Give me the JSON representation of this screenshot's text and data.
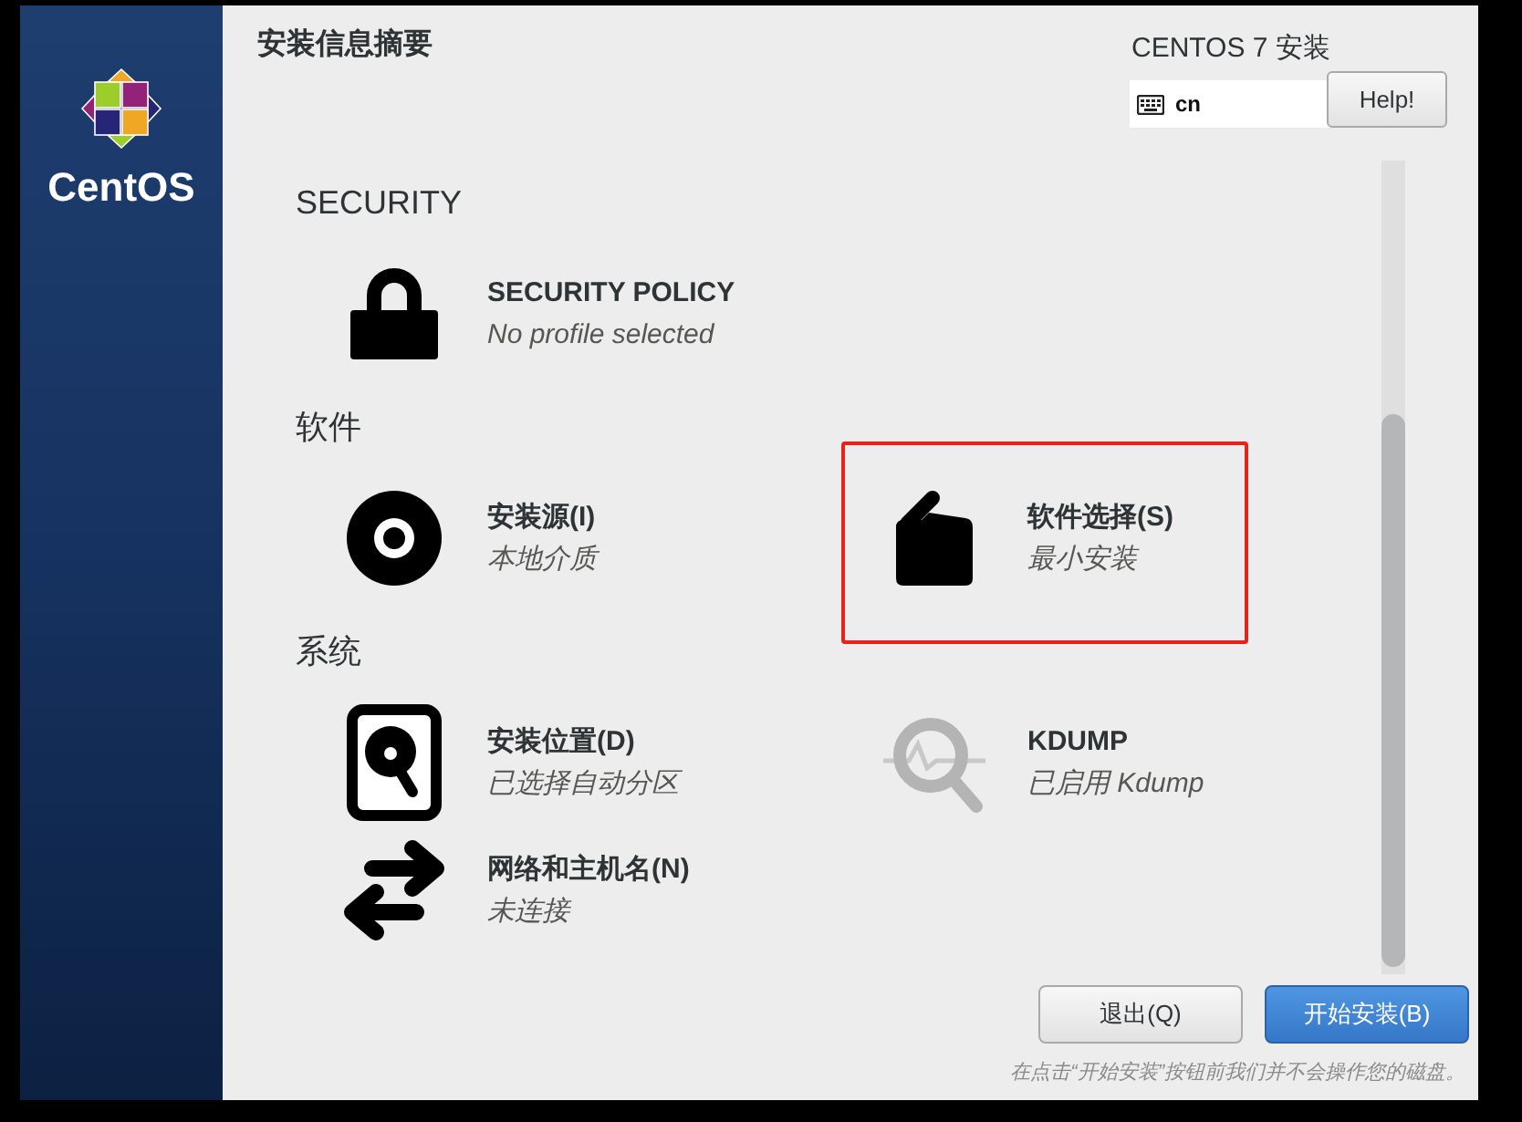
{
  "sidebar": {
    "brand": "CentOS"
  },
  "header": {
    "title": "安装信息摘要",
    "product": "CENTOS 7 安装",
    "keyboard_layout": "cn",
    "help_button": "Help!"
  },
  "sections": [
    {
      "heading": "SECURITY",
      "items": [
        {
          "kind": "lock",
          "title": "SECURITY POLICY",
          "status": "No profile selected",
          "highlighted": false
        }
      ]
    },
    {
      "heading": "软件",
      "items": [
        {
          "kind": "disc",
          "title": "安装源(I)",
          "status": "本地介质",
          "highlighted": false
        },
        {
          "kind": "package",
          "title": "软件选择(S)",
          "status": "最小安装",
          "highlighted": true
        }
      ]
    },
    {
      "heading": "系统",
      "items": [
        {
          "kind": "disk",
          "title": "安装位置(D)",
          "status": "已选择自动分区",
          "highlighted": false
        },
        {
          "kind": "kdump",
          "title": "KDUMP",
          "status": "已启用 Kdump",
          "highlighted": false
        },
        {
          "kind": "network",
          "title": "网络和主机名(N)",
          "status": "未连接",
          "highlighted": false
        }
      ]
    }
  ],
  "buttons": [
    {
      "kind": "secondary",
      "label": "退出(Q)"
    },
    {
      "kind": "primary",
      "label": "开始安装(B)"
    }
  ],
  "footer_note": "在点击“开始安装”按钮前我们并不会操作您的磁盘。"
}
